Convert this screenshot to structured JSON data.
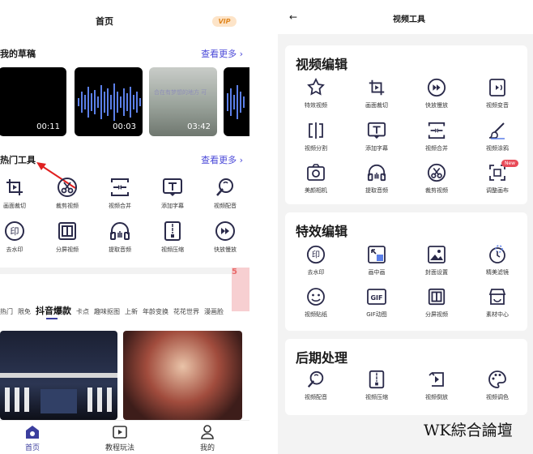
{
  "left": {
    "header_title": "首页",
    "vip_label": "VIP",
    "drafts": {
      "title": "我的草稿",
      "more": "查看更多 ›",
      "items": [
        {
          "duration": "00:11"
        },
        {
          "duration": "00:03"
        },
        {
          "duration": "03:42",
          "caption": "合在有梦想的地方 可"
        }
      ]
    },
    "hot_tools": {
      "title": "热门工具",
      "more": "查看更多 ›",
      "items": [
        {
          "label": "画面裁切",
          "icon": "crop-icon"
        },
        {
          "label": "裁剪视频",
          "icon": "scissors-icon"
        },
        {
          "label": "视频合并",
          "icon": "merge-icon"
        },
        {
          "label": "添加字幕",
          "icon": "text-icon"
        },
        {
          "label": "视频配音",
          "icon": "mic-icon"
        },
        {
          "label": "去水印",
          "icon": "watermark-icon"
        },
        {
          "label": "分屏视频",
          "icon": "split-screen-icon"
        },
        {
          "label": "提取音频",
          "icon": "headphones-icon"
        },
        {
          "label": "视频压缩",
          "icon": "zip-icon"
        },
        {
          "label": "快放慢放",
          "icon": "speed-icon"
        }
      ]
    },
    "template_tabs": [
      "热门",
      "限免",
      "抖音爆款",
      "卡点",
      "趣味抠图",
      "上新",
      "年龄变换",
      "花花世界",
      "漫画脸"
    ],
    "active_tab": "抖音爆款",
    "promo_text": "5",
    "bottom_nav": [
      {
        "label": "首页",
        "icon": "home-icon"
      },
      {
        "label": "教程玩法",
        "icon": "play-icon"
      },
      {
        "label": "我的",
        "icon": "user-icon"
      }
    ]
  },
  "right": {
    "header_title": "视频工具",
    "sections": [
      {
        "title": "视频编辑",
        "items": [
          {
            "label": "特效视频",
            "icon": "star-icon"
          },
          {
            "label": "画面裁切",
            "icon": "crop-icon"
          },
          {
            "label": "快放慢放",
            "icon": "speed-icon"
          },
          {
            "label": "视频变音",
            "icon": "voice-icon"
          },
          {
            "label": "视频分割",
            "icon": "split-icon"
          },
          {
            "label": "添加字幕",
            "icon": "text-icon"
          },
          {
            "label": "视频合并",
            "icon": "merge-icon"
          },
          {
            "label": "视频涂鸦",
            "icon": "brush-icon"
          },
          {
            "label": "美颜相机",
            "icon": "camera-icon"
          },
          {
            "label": "提取音频",
            "icon": "headphones-icon"
          },
          {
            "label": "裁剪视频",
            "icon": "scissors-icon"
          },
          {
            "label": "调整画布",
            "icon": "canvas-icon"
          }
        ],
        "new_badge": "New"
      },
      {
        "title": "特效编辑",
        "items": [
          {
            "label": "去水印",
            "icon": "watermark-icon"
          },
          {
            "label": "画中画",
            "icon": "pip-icon"
          },
          {
            "label": "封面设置",
            "icon": "image-icon"
          },
          {
            "label": "精美滤镜",
            "icon": "filter-icon"
          },
          {
            "label": "视频贴纸",
            "icon": "sticker-icon"
          },
          {
            "label": "GIF动图",
            "icon": "gif-icon"
          },
          {
            "label": "分屏视频",
            "icon": "split-screen-icon"
          },
          {
            "label": "素材中心",
            "icon": "store-icon"
          }
        ]
      },
      {
        "title": "后期处理",
        "items": [
          {
            "label": "视频配音",
            "icon": "mic-icon"
          },
          {
            "label": "视频压缩",
            "icon": "zip-icon"
          },
          {
            "label": "视频倒放",
            "icon": "reverse-icon"
          },
          {
            "label": "视频调色",
            "icon": "palette-icon"
          }
        ]
      }
    ]
  },
  "watermark": "WK綜合論壇",
  "colors": {
    "accent": "#3b3e9e",
    "link": "#4a48d8",
    "wave": "#5b7fe8",
    "badge": "#e84a57"
  }
}
